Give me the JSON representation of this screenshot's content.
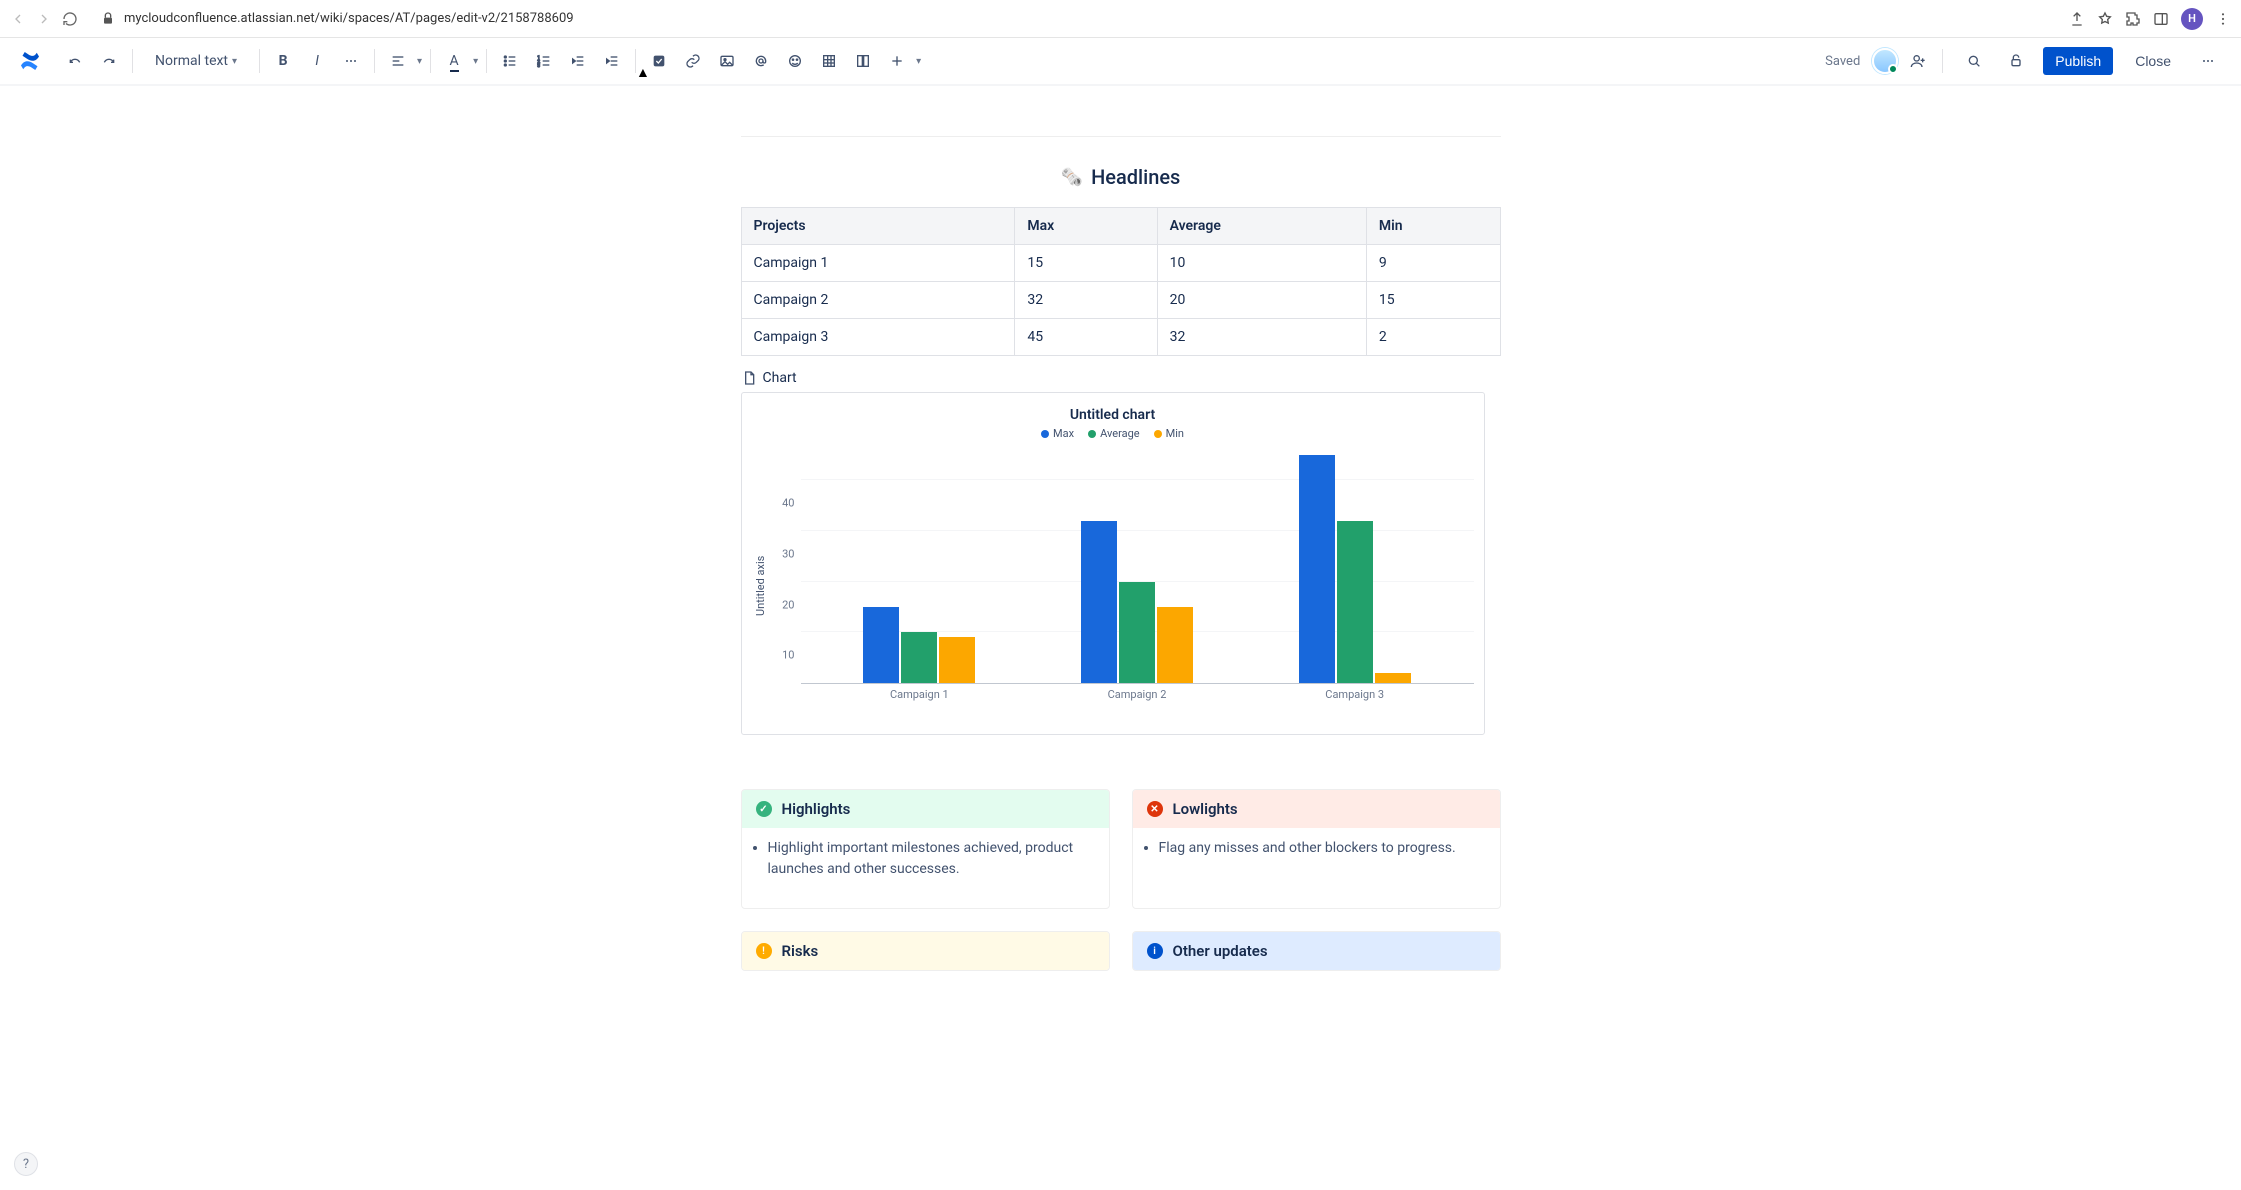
{
  "browser": {
    "url": "mycloudconfluence.atlassian.net/wiki/spaces/AT/pages/edit-v2/2158788609",
    "avatar_initial": "H"
  },
  "toolbar": {
    "text_style": "Normal text",
    "saved_label": "Saved",
    "publish_label": "Publish",
    "close_label": "Close"
  },
  "headlines": {
    "title": "Headlines",
    "emoji": "🗞️",
    "columns": [
      "Projects",
      "Max",
      "Average",
      "Min"
    ],
    "rows": [
      {
        "c0": "Campaign 1",
        "c1": "15",
        "c2": "10",
        "c3": "9"
      },
      {
        "c0": "Campaign 2",
        "c1": "32",
        "c2": "20",
        "c3": "15"
      },
      {
        "c0": "Campaign 3",
        "c1": "45",
        "c2": "32",
        "c3": "2"
      }
    ]
  },
  "chart_attachment_label": "Chart",
  "chart_data": {
    "type": "bar",
    "title": "Untitled chart",
    "ylabel": "Untitled axis",
    "ylim": [
      0,
      47
    ],
    "y_ticks": [
      10,
      20,
      30,
      40
    ],
    "categories": [
      "Campaign 1",
      "Campaign 2",
      "Campaign 3"
    ],
    "series": [
      {
        "name": "Max",
        "color": "#1868DB",
        "values": [
          15,
          32,
          45
        ]
      },
      {
        "name": "Average",
        "color": "#22A06B",
        "values": [
          10,
          20,
          32
        ]
      },
      {
        "name": "Min",
        "color": "#FCA700",
        "values": [
          9,
          15,
          2
        ]
      }
    ]
  },
  "panels": {
    "highlights": {
      "title": "Highlights",
      "item": "Highlight important milestones achieved, product launches and other successes."
    },
    "lowlights": {
      "title": "Lowlights",
      "item": "Flag any misses and other blockers to progress."
    },
    "risks": {
      "title": "Risks"
    },
    "other": {
      "title": "Other updates"
    }
  }
}
